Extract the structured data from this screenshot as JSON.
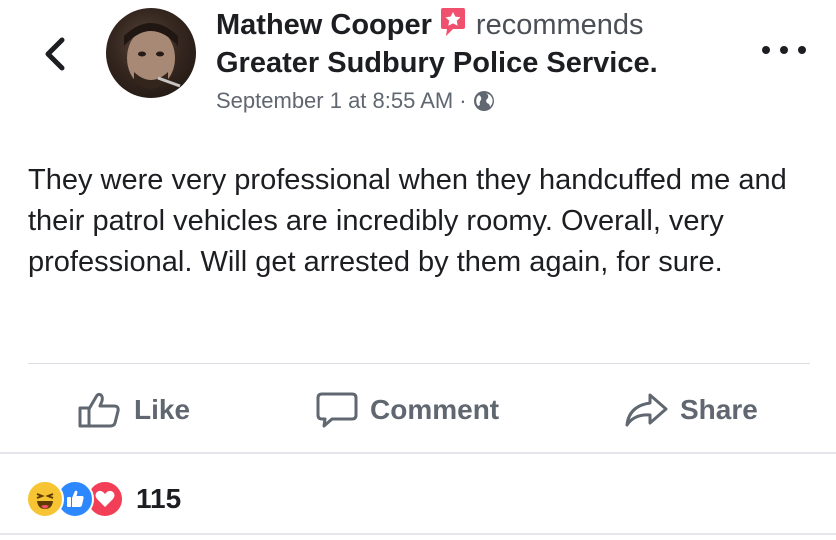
{
  "header": {
    "author": "Mathew Cooper",
    "recommends_text": "recommends",
    "page_name": "Greater Sudbury Police Service.",
    "timestamp": "September 1 at 8:55 AM",
    "separator": "·",
    "privacy_icon": "globe-icon",
    "badge_icon": "recommend-star-icon",
    "badge_color": "#f0506e"
  },
  "post": {
    "text": "They were very professional when they handcuffed me and their patrol vehicles are incredibly roomy. Overall, very professional. Will get arrested by them again, for sure."
  },
  "actions": {
    "like_label": "Like",
    "comment_label": "Comment",
    "share_label": "Share"
  },
  "reactions": {
    "icons": [
      "haha-reaction-icon",
      "like-reaction-icon",
      "love-reaction-icon"
    ],
    "count": "115"
  },
  "colors": {
    "text_primary": "#1c1e21",
    "text_secondary": "#606770",
    "like_blue": "#2d88ff",
    "love_red": "#f33e58",
    "haha_yellow": "#f7c533"
  }
}
